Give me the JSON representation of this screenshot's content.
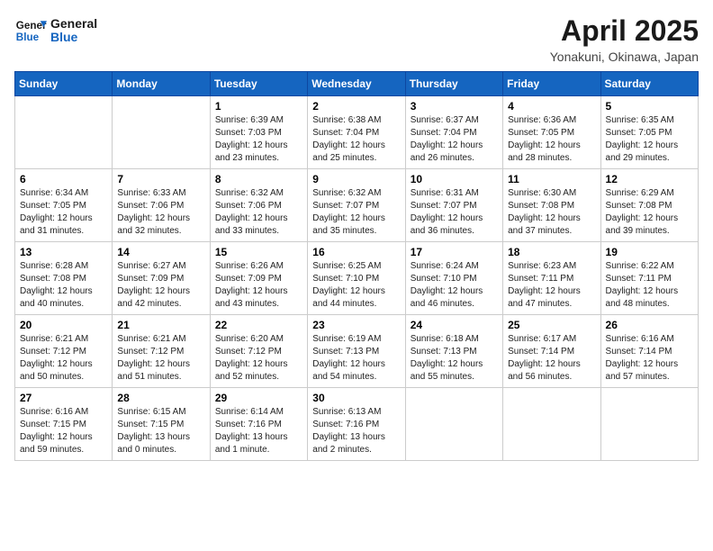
{
  "header": {
    "logo_line1": "General",
    "logo_line2": "Blue",
    "month_title": "April 2025",
    "location": "Yonakuni, Okinawa, Japan"
  },
  "days_of_week": [
    "Sunday",
    "Monday",
    "Tuesday",
    "Wednesday",
    "Thursday",
    "Friday",
    "Saturday"
  ],
  "weeks": [
    [
      {
        "day": "",
        "info": ""
      },
      {
        "day": "",
        "info": ""
      },
      {
        "day": "1",
        "info": "Sunrise: 6:39 AM\nSunset: 7:03 PM\nDaylight: 12 hours\nand 23 minutes."
      },
      {
        "day": "2",
        "info": "Sunrise: 6:38 AM\nSunset: 7:04 PM\nDaylight: 12 hours\nand 25 minutes."
      },
      {
        "day": "3",
        "info": "Sunrise: 6:37 AM\nSunset: 7:04 PM\nDaylight: 12 hours\nand 26 minutes."
      },
      {
        "day": "4",
        "info": "Sunrise: 6:36 AM\nSunset: 7:05 PM\nDaylight: 12 hours\nand 28 minutes."
      },
      {
        "day": "5",
        "info": "Sunrise: 6:35 AM\nSunset: 7:05 PM\nDaylight: 12 hours\nand 29 minutes."
      }
    ],
    [
      {
        "day": "6",
        "info": "Sunrise: 6:34 AM\nSunset: 7:05 PM\nDaylight: 12 hours\nand 31 minutes."
      },
      {
        "day": "7",
        "info": "Sunrise: 6:33 AM\nSunset: 7:06 PM\nDaylight: 12 hours\nand 32 minutes."
      },
      {
        "day": "8",
        "info": "Sunrise: 6:32 AM\nSunset: 7:06 PM\nDaylight: 12 hours\nand 33 minutes."
      },
      {
        "day": "9",
        "info": "Sunrise: 6:32 AM\nSunset: 7:07 PM\nDaylight: 12 hours\nand 35 minutes."
      },
      {
        "day": "10",
        "info": "Sunrise: 6:31 AM\nSunset: 7:07 PM\nDaylight: 12 hours\nand 36 minutes."
      },
      {
        "day": "11",
        "info": "Sunrise: 6:30 AM\nSunset: 7:08 PM\nDaylight: 12 hours\nand 37 minutes."
      },
      {
        "day": "12",
        "info": "Sunrise: 6:29 AM\nSunset: 7:08 PM\nDaylight: 12 hours\nand 39 minutes."
      }
    ],
    [
      {
        "day": "13",
        "info": "Sunrise: 6:28 AM\nSunset: 7:08 PM\nDaylight: 12 hours\nand 40 minutes."
      },
      {
        "day": "14",
        "info": "Sunrise: 6:27 AM\nSunset: 7:09 PM\nDaylight: 12 hours\nand 42 minutes."
      },
      {
        "day": "15",
        "info": "Sunrise: 6:26 AM\nSunset: 7:09 PM\nDaylight: 12 hours\nand 43 minutes."
      },
      {
        "day": "16",
        "info": "Sunrise: 6:25 AM\nSunset: 7:10 PM\nDaylight: 12 hours\nand 44 minutes."
      },
      {
        "day": "17",
        "info": "Sunrise: 6:24 AM\nSunset: 7:10 PM\nDaylight: 12 hours\nand 46 minutes."
      },
      {
        "day": "18",
        "info": "Sunrise: 6:23 AM\nSunset: 7:11 PM\nDaylight: 12 hours\nand 47 minutes."
      },
      {
        "day": "19",
        "info": "Sunrise: 6:22 AM\nSunset: 7:11 PM\nDaylight: 12 hours\nand 48 minutes."
      }
    ],
    [
      {
        "day": "20",
        "info": "Sunrise: 6:21 AM\nSunset: 7:12 PM\nDaylight: 12 hours\nand 50 minutes."
      },
      {
        "day": "21",
        "info": "Sunrise: 6:21 AM\nSunset: 7:12 PM\nDaylight: 12 hours\nand 51 minutes."
      },
      {
        "day": "22",
        "info": "Sunrise: 6:20 AM\nSunset: 7:12 PM\nDaylight: 12 hours\nand 52 minutes."
      },
      {
        "day": "23",
        "info": "Sunrise: 6:19 AM\nSunset: 7:13 PM\nDaylight: 12 hours\nand 54 minutes."
      },
      {
        "day": "24",
        "info": "Sunrise: 6:18 AM\nSunset: 7:13 PM\nDaylight: 12 hours\nand 55 minutes."
      },
      {
        "day": "25",
        "info": "Sunrise: 6:17 AM\nSunset: 7:14 PM\nDaylight: 12 hours\nand 56 minutes."
      },
      {
        "day": "26",
        "info": "Sunrise: 6:16 AM\nSunset: 7:14 PM\nDaylight: 12 hours\nand 57 minutes."
      }
    ],
    [
      {
        "day": "27",
        "info": "Sunrise: 6:16 AM\nSunset: 7:15 PM\nDaylight: 12 hours\nand 59 minutes."
      },
      {
        "day": "28",
        "info": "Sunrise: 6:15 AM\nSunset: 7:15 PM\nDaylight: 13 hours\nand 0 minutes."
      },
      {
        "day": "29",
        "info": "Sunrise: 6:14 AM\nSunset: 7:16 PM\nDaylight: 13 hours\nand 1 minute."
      },
      {
        "day": "30",
        "info": "Sunrise: 6:13 AM\nSunset: 7:16 PM\nDaylight: 13 hours\nand 2 minutes."
      },
      {
        "day": "",
        "info": ""
      },
      {
        "day": "",
        "info": ""
      },
      {
        "day": "",
        "info": ""
      }
    ]
  ]
}
